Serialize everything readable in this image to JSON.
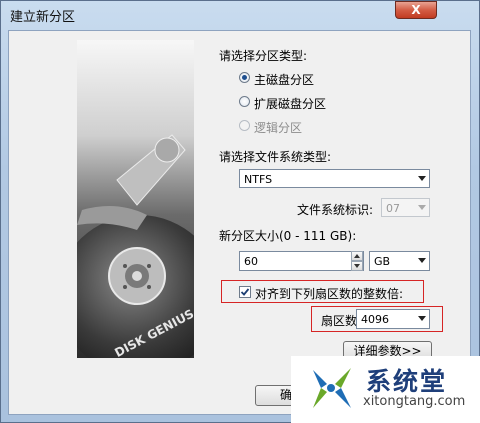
{
  "window": {
    "title": "建立新分区",
    "close_glyph": "X"
  },
  "sidebar": {
    "brand_text": "DISK GENIUS"
  },
  "partition_type": {
    "heading": "请选择分区类型:",
    "options": [
      {
        "label": "主磁盘分区",
        "selected": true,
        "enabled": true
      },
      {
        "label": "扩展磁盘分区",
        "selected": false,
        "enabled": true
      },
      {
        "label": "逻辑分区",
        "selected": false,
        "enabled": false
      }
    ]
  },
  "filesystem": {
    "heading": "请选择文件系统类型:",
    "selected": "NTFS",
    "id_label": "文件系统标识:",
    "id_value": "07"
  },
  "size": {
    "label": "新分区大小(0 - 111 GB):",
    "value": "60",
    "unit": "GB"
  },
  "align": {
    "checked": true,
    "label": "对齐到下列扇区数的整数倍:",
    "sectors_label": "扇区数:",
    "sectors_value": "4096"
  },
  "buttons": {
    "details": "详细参数>>",
    "ok_partial": "确"
  },
  "watermark": {
    "name": "系统堂",
    "url": "xitongtang.com"
  },
  "colors": {
    "annotation_red": "#d62525",
    "title_bar": "#b2c9e3",
    "watermark_blue": "#1f6db5",
    "watermark_green": "#6aa82a"
  }
}
